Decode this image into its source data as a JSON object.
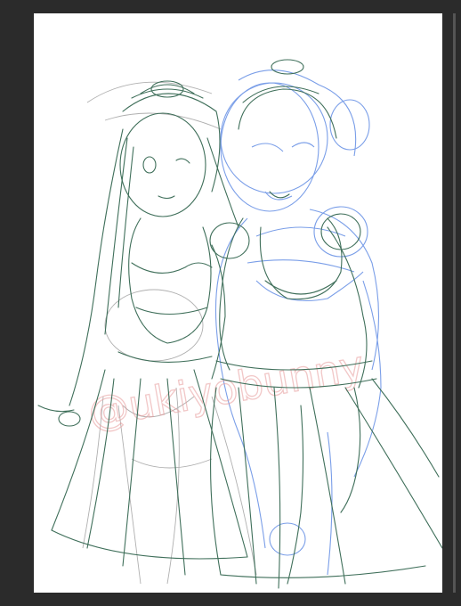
{
  "canvas": {
    "background": "#2b2b2b",
    "paper_color": "#ffffff"
  },
  "artwork": {
    "kind": "rough-sketch-illustration",
    "stroke_colors": {
      "left_figure": "#3f6f5a",
      "right_figure_guide": "#7a9ee8",
      "right_figure_lines": "#3f6f5a",
      "under_sketch": "#9c9c9c",
      "watermark": "#e79a9a"
    },
    "watermark_text": "@ukiyobunny"
  }
}
